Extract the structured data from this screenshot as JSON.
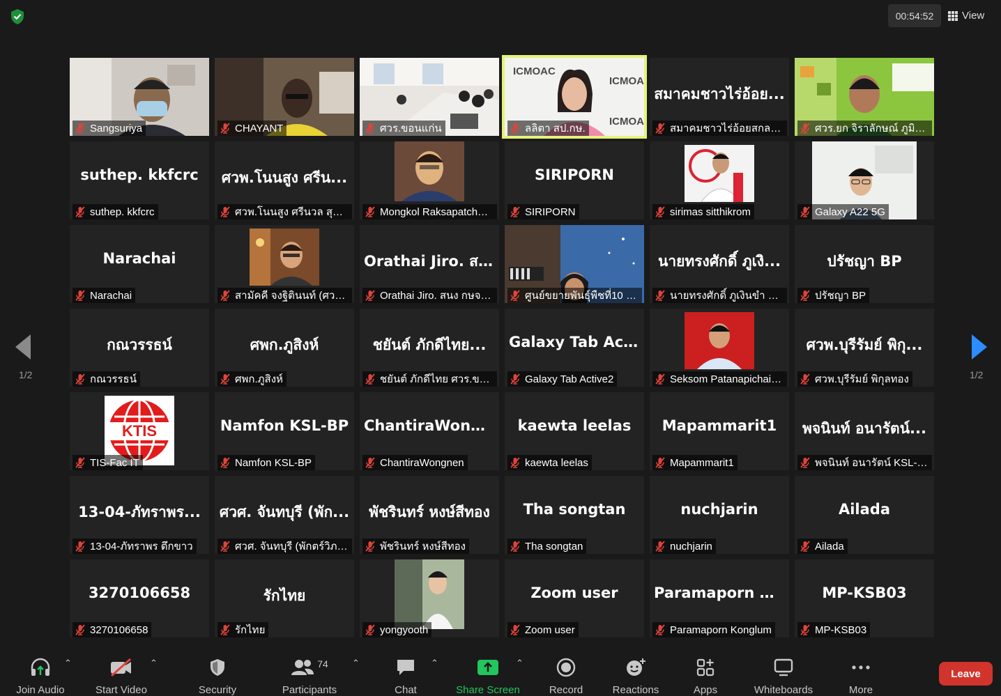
{
  "meeting": {
    "timer": "00:54:52",
    "view_label": "View",
    "page_indicator": "1/2",
    "colors": {
      "active_speaker": "#e6f27a",
      "leave": "#d0342c",
      "share": "#23c55e",
      "muted": "#e0443a"
    }
  },
  "participants": [
    {
      "name": "Sangsuriya",
      "display": "",
      "video": "person-mask"
    },
    {
      "name": "CHAYANT",
      "display": "",
      "video": "person-office"
    },
    {
      "name": "ศวร.ขอนแก่น",
      "display": "",
      "video": "meeting-room"
    },
    {
      "name": "ลลิตา สป.กษ.",
      "display": "",
      "video": "speaker-backdrop",
      "active": true
    },
    {
      "name": "สมาคมชาวไร่อ้อยสกลนคร",
      "display": "สมาคมชาวไร่อ้อย...",
      "video": ""
    },
    {
      "name": "ศวร.ยก จิราลักษณ์ ภูมิไธสง",
      "display": "",
      "video": "woman-green"
    },
    {
      "name": "suthep. kkfcrc",
      "display": "suthep. kkfcrc",
      "video": ""
    },
    {
      "name": "ศวพ.โนนสูง ศรีนวล สุราษ...",
      "display": "ศวพ.โนนสูง ศรีน...",
      "video": ""
    },
    {
      "name": "Mongkol Raksapatchar...",
      "display": "",
      "video": "portrait-man"
    },
    {
      "name": "SIRIPORN",
      "display": "SIRIPORN",
      "video": ""
    },
    {
      "name": "sirimas sitthikrom",
      "display": "",
      "video": "portrait-uniform"
    },
    {
      "name": "Galaxy A22 5G",
      "display": "",
      "video": "man-glasses"
    },
    {
      "name": "Narachai",
      "display": "Narachai",
      "video": ""
    },
    {
      "name": "สามัคคี จงฐิตินนท์ (ศวร.น...",
      "display": "",
      "video": "man-cafe"
    },
    {
      "name": "Orathai Jiro. สนง กษจ นว.",
      "display": "Orathai  Jiro. สน...",
      "video": ""
    },
    {
      "name": "ศูนย์ขยายพันธุ์พืชที่10 จ....",
      "display": "",
      "video": "woman-room"
    },
    {
      "name": "นายทรงศักดิ์ ภูเงินขำ KSL...",
      "display": "นายทรงศักดิ์  ภูเงิ...",
      "video": ""
    },
    {
      "name": "ปรัชญา BP",
      "display": "ปรัชญา BP",
      "video": ""
    },
    {
      "name": "กณวรรธน์",
      "display": "กณวรรธน์",
      "video": ""
    },
    {
      "name": "ศพก.ภูสิงห์",
      "display": "ศพก.ภูสิงห์",
      "video": ""
    },
    {
      "name": "ชยันต์  ภักดีไทย ศวร.ขอน...",
      "display": "ชยันต์  ภักดีไทย...",
      "video": ""
    },
    {
      "name": "Galaxy Tab Active2",
      "display": "Galaxy  Tab  Acti...",
      "video": ""
    },
    {
      "name": "Seksom Patanapichai : ...",
      "display": "",
      "video": "portrait-red"
    },
    {
      "name": "ศวพ.บุรีรัมย์  พิกุลทอง",
      "display": "ศวพ.บุรีรัมย์  พิกุ...",
      "video": ""
    },
    {
      "name": "TIS-Fac IT",
      "display": "",
      "video": "tis-logo"
    },
    {
      "name": "Namfon KSL-BP",
      "display": "Namfon KSL-BP",
      "video": ""
    },
    {
      "name": "ChantiraWongnen",
      "display": "ChantiraWongn...",
      "video": ""
    },
    {
      "name": "kaewta leelas",
      "display": "kaewta leelas",
      "video": ""
    },
    {
      "name": "Mapammarit1",
      "display": "Mapammarit1",
      "video": ""
    },
    {
      "name": "พจนินท์ อนารัตน์ KSL-np",
      "display": "พจนินท์ อนารัตน์...",
      "video": ""
    },
    {
      "name": "13-04-ภัทราพร  ตึกขาว",
      "display": "13-04-ภัทราพร...",
      "video": ""
    },
    {
      "name": "ศวศ. จันทบุรี (พักตร์วิภา สุ...",
      "display": "ศวศ. จันทบุรี (พัก...",
      "video": ""
    },
    {
      "name": "พัชรินทร์ หงษ์สีทอง",
      "display": "พัชรินทร์ หงษ์สีทอง",
      "video": ""
    },
    {
      "name": "Tha songtan",
      "display": "Tha songtan",
      "video": ""
    },
    {
      "name": "nuchjarin",
      "display": "nuchjarin",
      "video": ""
    },
    {
      "name": "Ailada",
      "display": "Ailada",
      "video": ""
    },
    {
      "name": "3270106658",
      "display": "3270106658",
      "video": ""
    },
    {
      "name": "รักไทย",
      "display": "รักไทย",
      "video": ""
    },
    {
      "name": "yongyooth",
      "display": "",
      "video": "portrait-outdoor"
    },
    {
      "name": "Zoom user",
      "display": "Zoom user",
      "video": ""
    },
    {
      "name": "Paramaporn Konglum",
      "display": "Paramaporn  Ko...",
      "video": ""
    },
    {
      "name": "MP-KSB03",
      "display": "MP-KSB03",
      "video": ""
    }
  ],
  "toolbar": {
    "join_audio": "Join Audio",
    "start_video": "Start Video",
    "security": "Security",
    "participants": "Participants",
    "participants_count": "74",
    "chat": "Chat",
    "share_screen": "Share Screen",
    "record": "Record",
    "reactions": "Reactions",
    "apps": "Apps",
    "whiteboards": "Whiteboards",
    "more": "More",
    "leave": "Leave"
  }
}
